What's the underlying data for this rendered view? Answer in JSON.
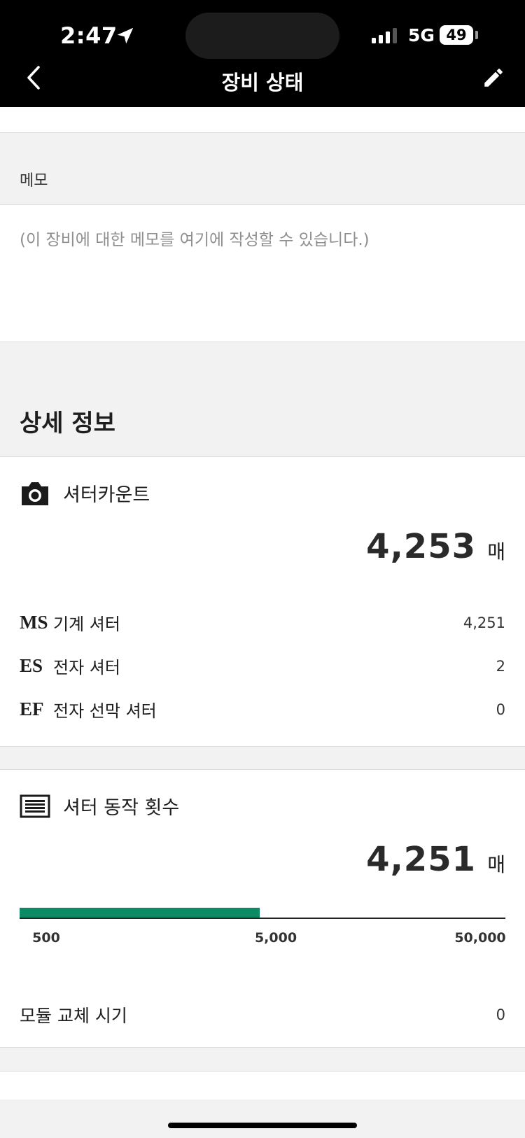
{
  "status_bar": {
    "time": "2:47",
    "network": "5G",
    "battery": "49"
  },
  "header": {
    "title": "장비 상태"
  },
  "memo": {
    "heading": "메모",
    "placeholder": "(이 장비에 대한 메모를 여기에 작성할 수 있습니다.)"
  },
  "details": {
    "title": "상세 정보",
    "shutter_count": {
      "label": "셔터카운트",
      "value": "4,253",
      "unit": "매",
      "icon": "camera-icon",
      "rows": [
        {
          "code": "MS",
          "label": "기계 셔터",
          "value": "4,251"
        },
        {
          "code": "ES",
          "label": "전자 셔터",
          "value": "2"
        },
        {
          "code": "EF",
          "label": "전자 선막 셔터",
          "value": "0"
        }
      ]
    },
    "shutter_actuations": {
      "label": "셔터 동작 횟수",
      "value": "4,251",
      "unit": "매",
      "icon": "shutter-icon",
      "progress": {
        "value": 4251,
        "scale": "log",
        "ticks": [
          "500",
          "5,000",
          "50,000"
        ],
        "color": "#0c8a64"
      }
    },
    "module_replacement": {
      "label": "모듈 교체 시기",
      "value": "0"
    }
  }
}
